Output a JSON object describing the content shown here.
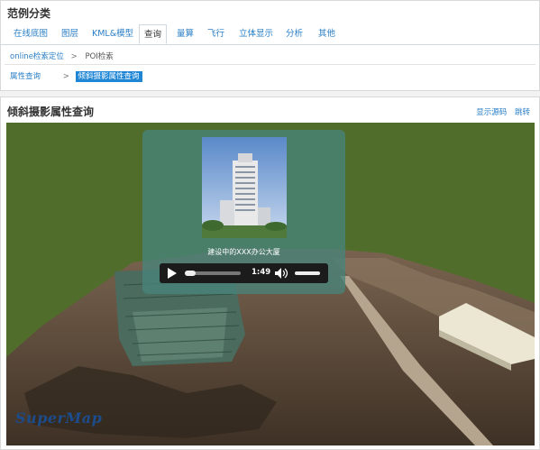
{
  "top_panel": {
    "title": "范例分类",
    "tabs": [
      {
        "label": "在线底图"
      },
      {
        "label": "图层"
      },
      {
        "label": "KML&模型"
      },
      {
        "label": "查询",
        "active": true
      },
      {
        "label": "量算"
      },
      {
        "label": "飞行"
      },
      {
        "label": "立体显示"
      },
      {
        "label": "分析"
      },
      {
        "label": "其他"
      }
    ],
    "row1": {
      "link1": "online检索定位",
      "sep": ">",
      "link2": "POI检索"
    },
    "row2": {
      "label": "属性查询",
      "sep": ">",
      "selected": "倾斜摄影属性查询"
    }
  },
  "bottom_panel": {
    "title": "倾斜摄影属性查询",
    "show_source": "显示源码",
    "jump": "跳转"
  },
  "scene": {
    "popup_caption": "建设中的XXX办公大厦",
    "player_time": "1:49",
    "logo_text": "SuperMap"
  },
  "colors": {
    "accent": "#1f86d6",
    "link": "#2a7fc6",
    "popup": "#48847a"
  }
}
